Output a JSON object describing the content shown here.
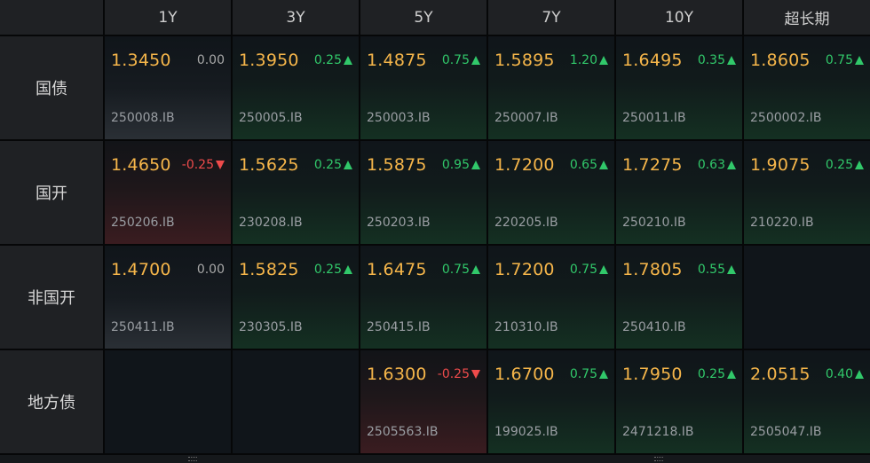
{
  "columns": [
    "1Y",
    "3Y",
    "5Y",
    "7Y",
    "10Y",
    "超长期"
  ],
  "rows": [
    {
      "label": "国债",
      "cells": [
        {
          "rate": "1.3450",
          "change": "0.00",
          "direction": "flat",
          "code": "250008.IB"
        },
        {
          "rate": "1.3950",
          "change": "0.25",
          "direction": "up",
          "code": "250005.IB"
        },
        {
          "rate": "1.4875",
          "change": "0.75",
          "direction": "up",
          "code": "250003.IB"
        },
        {
          "rate": "1.5895",
          "change": "1.20",
          "direction": "up",
          "code": "250007.IB"
        },
        {
          "rate": "1.6495",
          "change": "0.35",
          "direction": "up",
          "code": "250011.IB"
        },
        {
          "rate": "1.8605",
          "change": "0.75",
          "direction": "up",
          "code": "2500002.IB"
        }
      ]
    },
    {
      "label": "国开",
      "cells": [
        {
          "rate": "1.4650",
          "change": "-0.25",
          "direction": "down",
          "code": "250206.IB"
        },
        {
          "rate": "1.5625",
          "change": "0.25",
          "direction": "up",
          "code": "230208.IB"
        },
        {
          "rate": "1.5875",
          "change": "0.95",
          "direction": "up",
          "code": "250203.IB"
        },
        {
          "rate": "1.7200",
          "change": "0.65",
          "direction": "up",
          "code": "220205.IB"
        },
        {
          "rate": "1.7275",
          "change": "0.63",
          "direction": "up",
          "code": "250210.IB"
        },
        {
          "rate": "1.9075",
          "change": "0.25",
          "direction": "up",
          "code": "210220.IB"
        }
      ]
    },
    {
      "label": "非国开",
      "cells": [
        {
          "rate": "1.4700",
          "change": "0.00",
          "direction": "flat",
          "code": "250411.IB"
        },
        {
          "rate": "1.5825",
          "change": "0.25",
          "direction": "up",
          "code": "230305.IB"
        },
        {
          "rate": "1.6475",
          "change": "0.75",
          "direction": "up",
          "code": "250415.IB"
        },
        {
          "rate": "1.7200",
          "change": "0.75",
          "direction": "up",
          "code": "210310.IB"
        },
        {
          "rate": "1.7805",
          "change": "0.55",
          "direction": "up",
          "code": "250410.IB"
        },
        null
      ]
    },
    {
      "label": "地方债",
      "cells": [
        null,
        null,
        {
          "rate": "1.6300",
          "change": "-0.25",
          "direction": "down",
          "code": "2505563.IB"
        },
        {
          "rate": "1.6700",
          "change": "0.75",
          "direction": "up",
          "code": "199025.IB"
        },
        {
          "rate": "1.7950",
          "change": "0.25",
          "direction": "up",
          "code": "2471218.IB"
        },
        {
          "rate": "2.0515",
          "change": "0.40",
          "direction": "up",
          "code": "2505047.IB"
        }
      ]
    }
  ],
  "colors": {
    "rate": "#f6b64a",
    "up": "#31c86a",
    "down": "#ee4b4b",
    "flat": "#a8a8a8",
    "code": "#9a9ea3",
    "header_bg": "#1f2124",
    "cell_bg": "#10151a"
  },
  "icons": {
    "up": "up-triangle-icon",
    "down": "down-triangle-icon"
  }
}
